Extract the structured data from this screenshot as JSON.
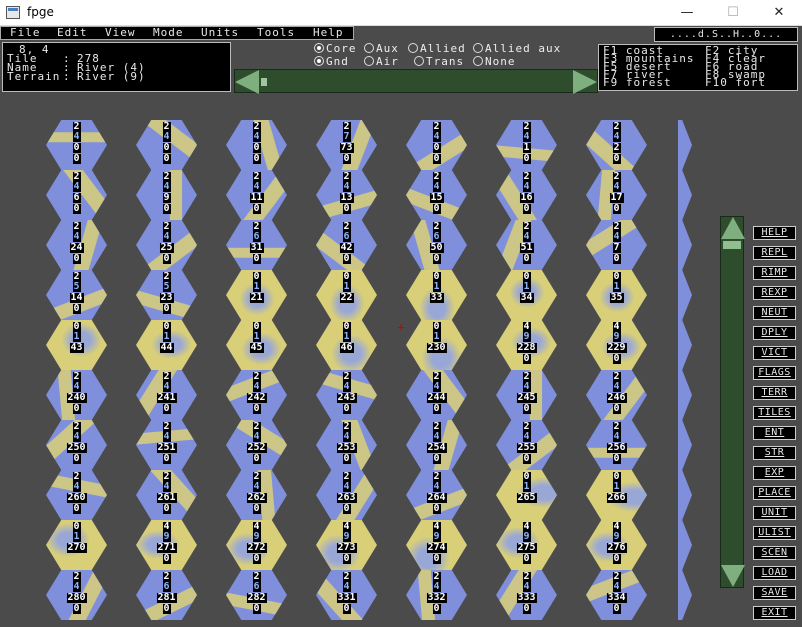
{
  "window": {
    "title": "fpge",
    "minimize": "—",
    "maximize": "☐",
    "close": "✕"
  },
  "menu": [
    "File",
    "Edit",
    "View",
    "Mode",
    "Units",
    "Tools",
    "Help"
  ],
  "status": "....d.S..H..0...",
  "info": {
    "coords": "8, 4",
    "tile_label": "Tile",
    "tile_value": "278",
    "name_label": "Name",
    "name_value": "River (4)",
    "terrain_label": "Terrain",
    "terrain_value": "River (9)",
    "sep": ":"
  },
  "radio_row1": [
    {
      "label": "Core",
      "on": true
    },
    {
      "label": "Aux",
      "on": false
    },
    {
      "label": "Allied",
      "on": false
    },
    {
      "label": "Allied aux",
      "on": false
    }
  ],
  "radio_row2": [
    {
      "label": "Gnd",
      "on": true
    },
    {
      "label": "Air",
      "on": false
    },
    {
      "label": "Trans",
      "on": false
    },
    {
      "label": "None",
      "on": false
    }
  ],
  "keys": [
    [
      "F1 coast",
      "F2 city"
    ],
    [
      "F3 mountains",
      "F4 clear"
    ],
    [
      "F5 desert",
      "F6 road"
    ],
    [
      "F7 river",
      "F8 swamp"
    ],
    [
      "F9 forest",
      "F10 fort"
    ]
  ],
  "side_buttons": [
    "HELP",
    "REPL",
    "RIMP",
    "REXP",
    "NEUT",
    "DPLY",
    "VICT",
    "FLAGS",
    "TERR",
    "TILES",
    "ENT",
    "STR",
    "EXP",
    "PLACE",
    "UNIT",
    "ULIST",
    "SCEN",
    "LOAD",
    "SAVE",
    "EXIT"
  ],
  "hex_columns": [
    [
      [
        "2",
        "4",
        "0",
        "0"
      ],
      [
        "2",
        "4",
        "6",
        "0"
      ],
      [
        "2",
        "4",
        "24",
        "0"
      ],
      [
        "2",
        "5",
        "14",
        "0"
      ],
      [
        "0",
        "1",
        "43",
        ""
      ],
      [
        "2",
        "4",
        "240",
        "0"
      ],
      [
        "2",
        "4",
        "250",
        "0"
      ],
      [
        "2",
        "4",
        "260",
        "0"
      ],
      [
        "0",
        "1",
        "270",
        ""
      ],
      [
        "2",
        "4",
        "280",
        "0"
      ]
    ],
    [
      [
        "2",
        "4",
        "0",
        "0"
      ],
      [
        "2",
        "4",
        "9",
        "0"
      ],
      [
        "2",
        "4",
        "25",
        "0"
      ],
      [
        "2",
        "5",
        "23",
        "0"
      ],
      [
        "0",
        "1",
        "44",
        ""
      ],
      [
        "2",
        "4",
        "241",
        "0"
      ],
      [
        "2",
        "4",
        "251",
        "0"
      ],
      [
        "2",
        "4",
        "261",
        "0"
      ],
      [
        "4",
        "9",
        "271",
        "0"
      ],
      [
        "2",
        "6",
        "281",
        "0"
      ]
    ],
    [
      [
        "2",
        "4",
        "0",
        "0"
      ],
      [
        "2",
        "4",
        "11",
        "0"
      ],
      [
        "2",
        "6",
        "31",
        "0"
      ],
      [
        "0",
        "1",
        "21",
        ""
      ],
      [
        "0",
        "1",
        "45",
        ""
      ],
      [
        "2",
        "4",
        "242",
        "0"
      ],
      [
        "2",
        "4",
        "252",
        "0"
      ],
      [
        "2",
        "4",
        "262",
        "0"
      ],
      [
        "4",
        "9",
        "272",
        "0"
      ],
      [
        "2",
        "6",
        "282",
        "0"
      ]
    ],
    [
      [
        "2",
        "7",
        "73",
        "0"
      ],
      [
        "2",
        "4",
        "13",
        "0"
      ],
      [
        "2",
        "6",
        "42",
        "0"
      ],
      [
        "0",
        "1",
        "22",
        ""
      ],
      [
        "0",
        "1",
        "46",
        ""
      ],
      [
        "2",
        "4",
        "243",
        "0"
      ],
      [
        "2",
        "4",
        "253",
        "0"
      ],
      [
        "2",
        "4",
        "263",
        "0"
      ],
      [
        "4",
        "9",
        "273",
        "0"
      ],
      [
        "2",
        "4",
        "331",
        "0"
      ]
    ],
    [
      [
        "2",
        "4",
        "0",
        "0"
      ],
      [
        "2",
        "4",
        "15",
        "0"
      ],
      [
        "2",
        "6",
        "50",
        "0"
      ],
      [
        "0",
        "1",
        "33",
        ""
      ],
      [
        "0",
        "1",
        "230",
        ""
      ],
      [
        "2",
        "4",
        "244",
        "0"
      ],
      [
        "2",
        "4",
        "254",
        "0"
      ],
      [
        "2",
        "4",
        "264",
        "0"
      ],
      [
        "4",
        "9",
        "274",
        "0"
      ],
      [
        "2",
        "4",
        "332",
        "0"
      ]
    ],
    [
      [
        "2",
        "4",
        "1",
        "0"
      ],
      [
        "2",
        "4",
        "16",
        "0"
      ],
      [
        "2",
        "4",
        "51",
        "0"
      ],
      [
        "0",
        "1",
        "34",
        ""
      ],
      [
        "4",
        "9",
        "228",
        "0"
      ],
      [
        "2",
        "4",
        "245",
        "0"
      ],
      [
        "2",
        "4",
        "255",
        "0"
      ],
      [
        "0",
        "1",
        "265",
        ""
      ],
      [
        "4",
        "9",
        "275",
        "0"
      ],
      [
        "2",
        "4",
        "333",
        "0"
      ]
    ],
    [
      [
        "2",
        "4",
        "2",
        "0"
      ],
      [
        "2",
        "4",
        "17",
        "0"
      ],
      [
        "2",
        "4",
        "7",
        "0"
      ],
      [
        "0",
        "1",
        "35",
        ""
      ],
      [
        "4",
        "9",
        "229",
        "0"
      ],
      [
        "2",
        "4",
        "246",
        "0"
      ],
      [
        "2",
        "4",
        "256",
        "0"
      ],
      [
        "0",
        "1",
        "266",
        ""
      ],
      [
        "4",
        "9",
        "276",
        "0"
      ],
      [
        "2",
        "4",
        "334",
        "0"
      ]
    ]
  ],
  "cursor_glyph": "+"
}
